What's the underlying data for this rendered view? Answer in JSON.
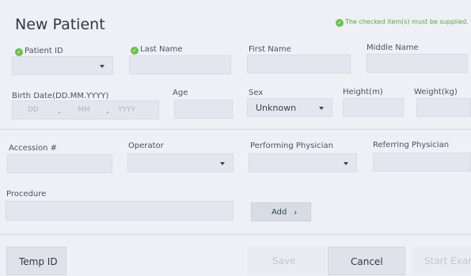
{
  "dialog": {
    "title": "New Patient",
    "required_notice": "The checked item(s) must be supplied."
  },
  "fields": {
    "patient_id_label": "Patient ID",
    "last_name_label": "Last Name",
    "first_name_label": "First Name",
    "middle_name_label": "Middle Name",
    "birth_date_label": "Birth Date(DD.MM.YYYY)",
    "birth_dd_placeholder": "DD",
    "birth_mm_placeholder": "MM",
    "birth_yyyy_placeholder": "YYYY",
    "birth_separator": ".",
    "age_label": "Age",
    "sex_label": "Sex",
    "sex_value": "Unknown",
    "height_label": "Height(m)",
    "weight_label": "Weight(kg)",
    "accession_label": "Accession #",
    "operator_label": "Operator",
    "performing_physician_label": "Performing Physician",
    "referring_physician_label": "Referring Physician",
    "procedure_label": "Procedure"
  },
  "buttons": {
    "add_label": "Add",
    "add_chevron": "›",
    "temp_id_label": "Temp ID",
    "save_label": "Save",
    "cancel_label": "Cancel",
    "start_exam_label": "Start Exam"
  },
  "colors": {
    "background": "#eef0f5",
    "field": "#e3e6ee",
    "required_check": "#6cbf4f",
    "notice_text": "#5aa64a"
  }
}
